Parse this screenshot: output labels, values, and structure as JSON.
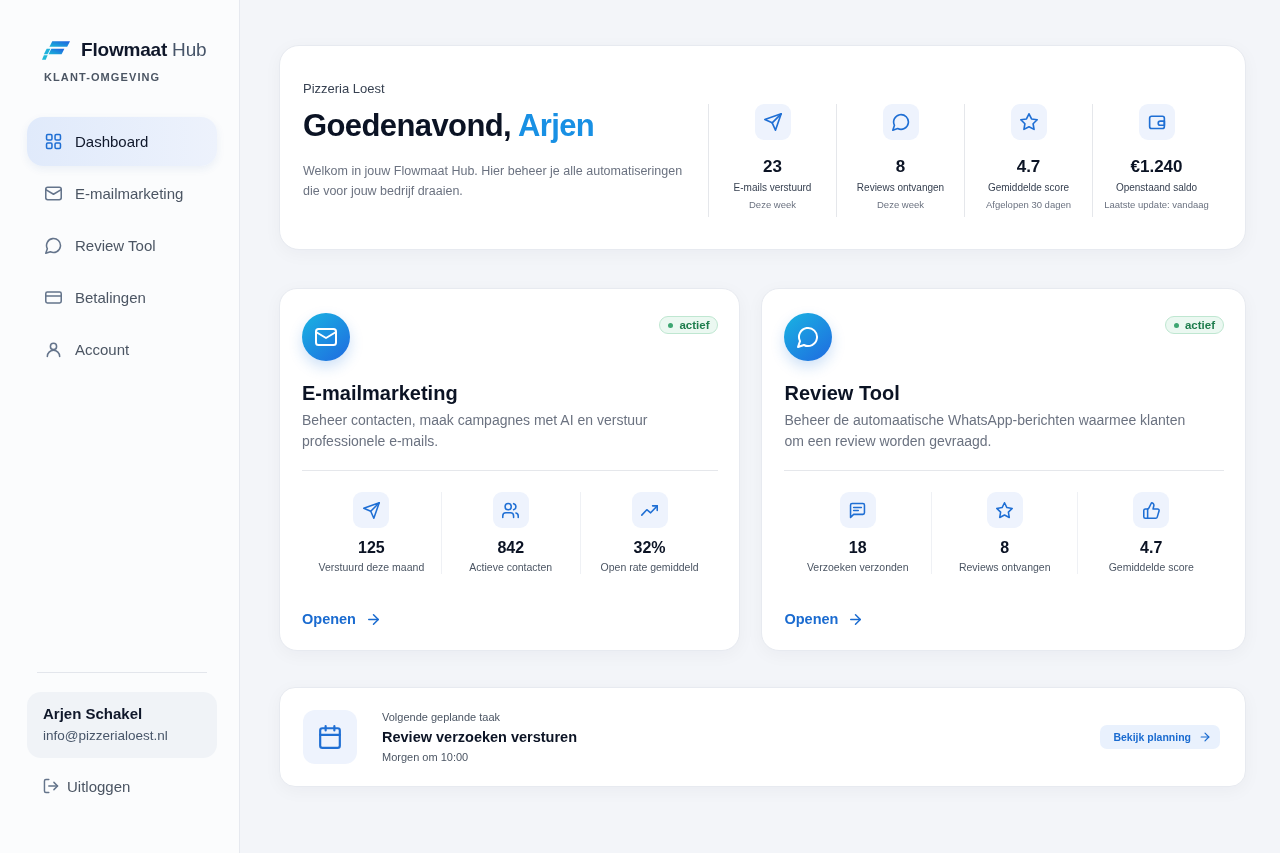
{
  "sidebar": {
    "brand": "**Flowmaat** Hub",
    "subtitle": "KLANT-OMGEVING",
    "items": [
      {
        "label": "Dashboard",
        "selected": true
      },
      {
        "label": "E-mailmarketing",
        "selected": false
      },
      {
        "label": "Review Tool",
        "selected": false
      },
      {
        "label": "Betalingen",
        "selected": false
      },
      {
        "label": "Account",
        "selected": false
      }
    ],
    "user": {
      "name": "Arjen Schakel",
      "email": "info@pizzerialoest.nl"
    },
    "logout": "Uitloggen"
  },
  "welcome": {
    "business": "Pizzeria Loest",
    "greeting": "Goedenavond,",
    "name": "Arjen",
    "intro": "Welkom in jouw Flowmaat Hub. Hier beheer je alle automatiseringen die voor jouw bedrijf draaien.",
    "stats": [
      {
        "value": "23",
        "label": "E-mails verstuurd",
        "period": "Deze week"
      },
      {
        "value": "8",
        "label": "Reviews ontvangen",
        "period": "Deze week"
      },
      {
        "value": "4.7",
        "label": "Gemiddelde score",
        "period": "Afgelopen 30 dagen"
      },
      {
        "value": "€1.240",
        "label": "Openstaand saldo",
        "period": "Laatste update: vandaag"
      }
    ]
  },
  "modules": [
    {
      "title": "E-mailmarketing",
      "status": "actief",
      "description": "Beheer contacten, maak campagnes met AI en verstuur professionele e-mails.",
      "stats": [
        {
          "value": "125",
          "label": "Verstuurd deze maand"
        },
        {
          "value": "842",
          "label": "Actieve contacten"
        },
        {
          "value": "32%",
          "label": "Open rate gemiddeld"
        }
      ],
      "link": "Openen"
    },
    {
      "title": "Review Tool",
      "status": "actief",
      "description": "Beheer de automaatische WhatsApp-berichten waarmee klanten om een review worden gevraagd.",
      "stats": [
        {
          "value": "18",
          "label": "Verzoeken verzonden"
        },
        {
          "value": "8",
          "label": "Reviews ontvangen"
        },
        {
          "value": "4.7",
          "label": "Gemiddelde score"
        }
      ],
      "link": "Openen"
    }
  ],
  "next_task": {
    "label": "Volgende geplande taak",
    "title": "Review verzoeken versturen",
    "time": "Morgen om 10:00",
    "button": "Bekijk planning"
  }
}
